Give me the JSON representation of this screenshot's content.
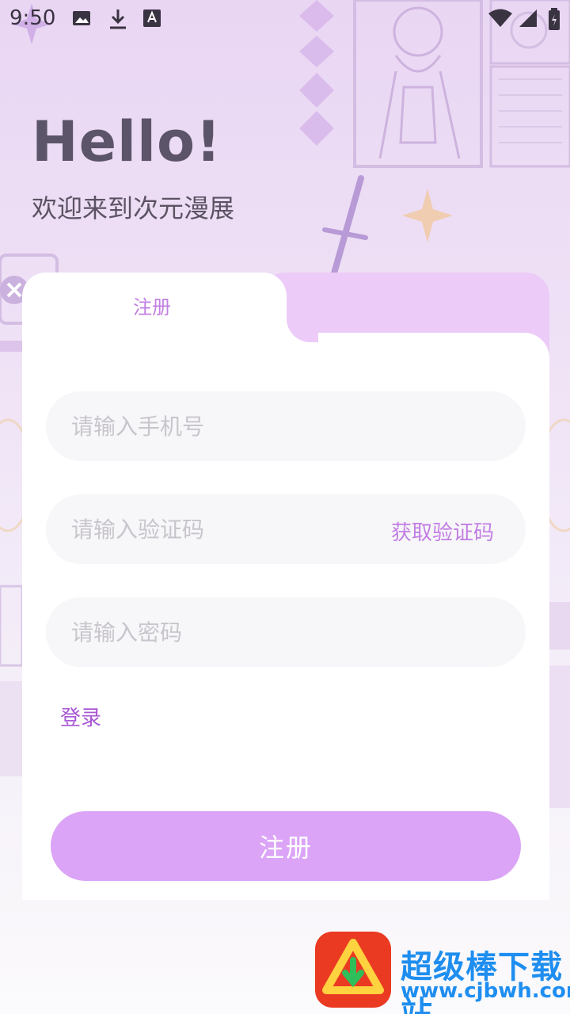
{
  "status_bar": {
    "time": "9:50",
    "left_icons": [
      "image-icon",
      "download-icon",
      "font-icon"
    ],
    "right_icons": [
      "wifi-icon",
      "signal-icon",
      "battery-icon"
    ]
  },
  "greeting": {
    "title": "Hello!",
    "subtitle": "欢迎来到次元漫展"
  },
  "tabs": {
    "active_label": "注册"
  },
  "form": {
    "phone_placeholder": "请输入手机号",
    "code_placeholder": "请输入验证码",
    "get_code_label": "获取验证码",
    "password_placeholder": "请输入密码",
    "login_link": "登录",
    "submit_label": "注册"
  },
  "watermark": {
    "title": "超级棒下载站",
    "url": "www.cjbwh.com"
  },
  "colors": {
    "accent": "#c27fe3",
    "button": "#dba4f6",
    "tab_inactive": "#eccbf8",
    "field_bg": "#f7f6f9"
  }
}
